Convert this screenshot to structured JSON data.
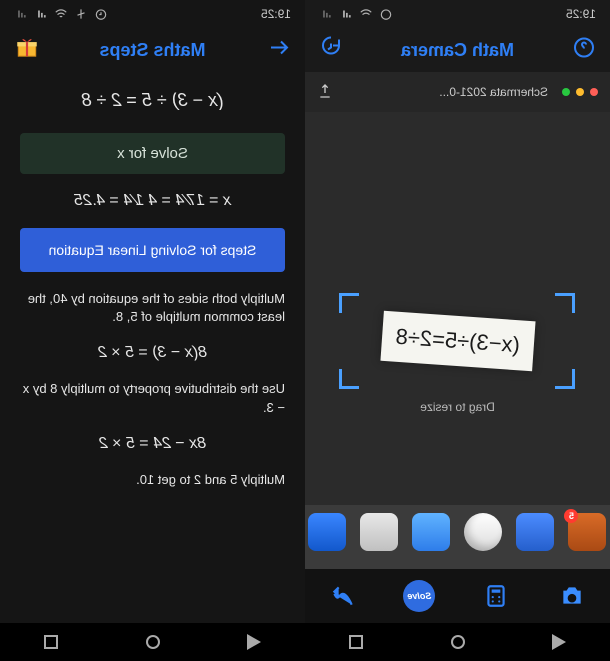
{
  "status": {
    "time": "19:25"
  },
  "left": {
    "title": "Maths Steps",
    "equation": "(x − 3) ÷ 5 = 2 ÷ 8",
    "solve_label": "Solve for x",
    "result": "x = 17⁄4 = 4 1⁄4 = 4.25",
    "steps_button": "Steps for Solving Linear Equation",
    "step1": "Multiply both sides of the equation by 40, the least common multiple of 5, 8.",
    "eq1": "8(x − 3) = 5 × 2",
    "step2": "Use the distributive property to multiply 8 by x − 3.",
    "eq2": "8x − 24 = 5 × 2",
    "step3": "Multiply 5 and 2 to get 10."
  },
  "right": {
    "title": "Math Camera",
    "preview_title": "Schermata 2021-0...",
    "badge": "5",
    "drag_label": "Drag to resize",
    "equation": "(x−3)÷5=2÷8",
    "nav": {
      "solve": "Solve"
    }
  }
}
